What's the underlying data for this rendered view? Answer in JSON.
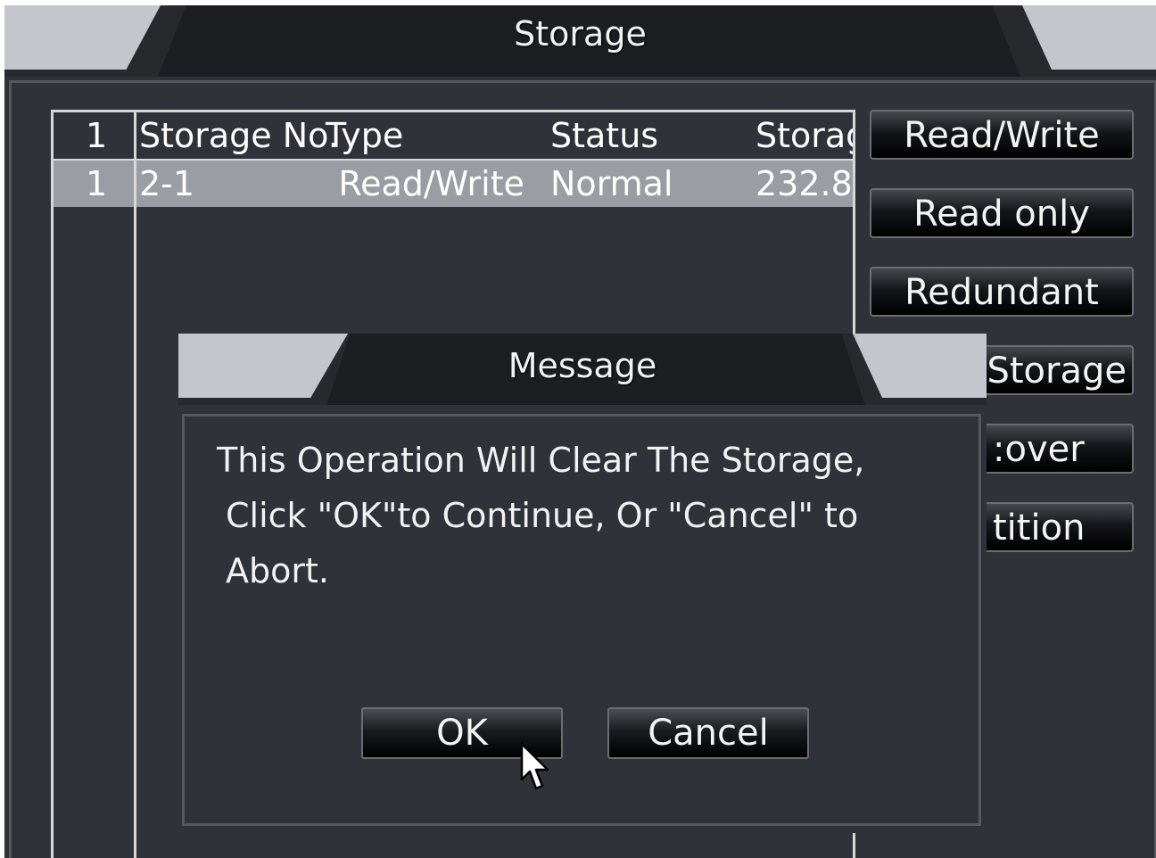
{
  "window": {
    "title": "Storage"
  },
  "table": {
    "header": {
      "index": "1",
      "storage_no": "Storage No.",
      "type": "Type",
      "status": "Status",
      "capacity": "Storag"
    },
    "rows": [
      {
        "index": "1",
        "storage_no": "2-1",
        "type": "Read/Write",
        "status": "Normal",
        "capacity": "232.8"
      }
    ]
  },
  "side_buttons": {
    "read_write": "Read/Write",
    "read_only": "Read only",
    "redundant": "Redundant",
    "format_storage": "Storage",
    "recover": ":over",
    "partition": "tition"
  },
  "dialog": {
    "title": "Message",
    "lines": [
      "This Operation Will Clear The Storage,",
      "Click \"OK\"to Continue, Or \"Cancel\" to",
      "Abort."
    ],
    "ok_label": "OK",
    "cancel_label": "Cancel"
  },
  "icons": {
    "pointer": "mouse-pointer-icon"
  }
}
